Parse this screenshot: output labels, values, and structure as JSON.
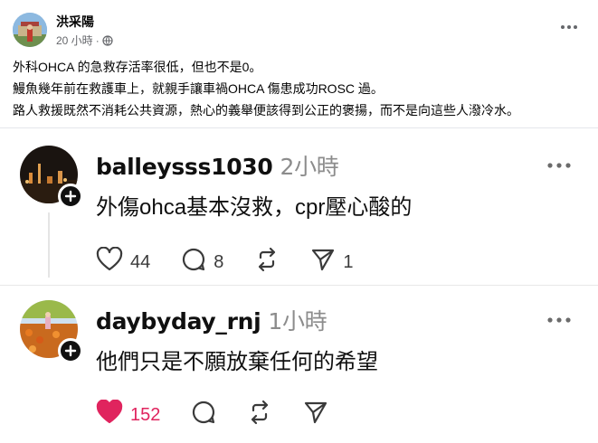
{
  "post": {
    "author": "洪采陽",
    "time": "20 小時",
    "meta_separator": "·",
    "privacy_icon": "globe-icon",
    "lines": [
      "外科OHCA 的急救存活率很低，但也不是0。",
      "鰻魚幾年前在救護車上，就親手讓車禍OHCA 傷患成功ROSC 過。",
      "路人救援既然不消耗公共資源，熱心的義舉便該得到公正的褒揚，而不是向這些人潑冷水。"
    ]
  },
  "comments": [
    {
      "username": "balleysss1030",
      "time": "2小時",
      "text": "外傷ohca基本沒救，cpr壓心酸的",
      "likes": "44",
      "replies": "8",
      "reposts": "",
      "shares": "1",
      "liked": false
    },
    {
      "username": "daybyday_rnj",
      "time": "1小時",
      "text": "他們只是不願放棄任何的希望",
      "likes": "152",
      "replies": "",
      "reposts": "",
      "shares": "",
      "liked": true
    }
  ],
  "colors": {
    "liked": "#e0245e",
    "muted": "#8c8c8c",
    "text": "#101010"
  }
}
